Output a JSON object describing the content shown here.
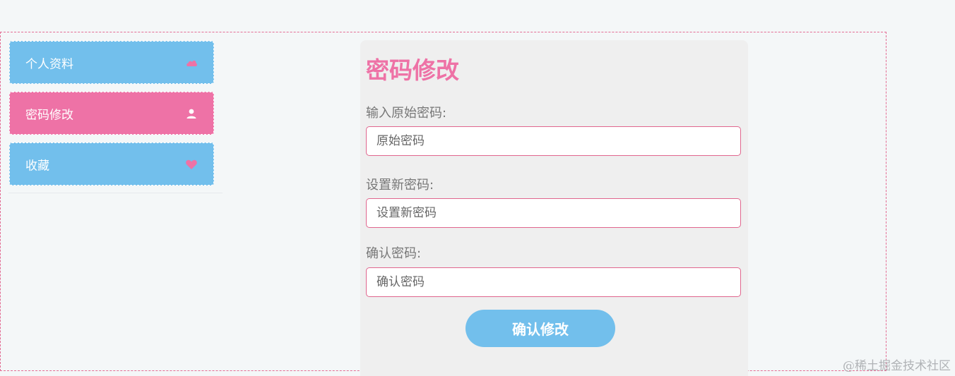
{
  "sidebar": {
    "items": [
      {
        "label": "个人资料",
        "icon": "cloud-icon",
        "color": "#72bfec",
        "active": false
      },
      {
        "label": "密码修改",
        "icon": "user-icon",
        "color": "#ee72a6",
        "active": true
      },
      {
        "label": "收藏",
        "icon": "heart-icon",
        "color": "#72bfec",
        "active": false
      }
    ]
  },
  "form": {
    "title": "密码修改",
    "fields": [
      {
        "label": "输入原始密码:",
        "placeholder": "原始密码",
        "value": ""
      },
      {
        "label": "设置新密码:",
        "placeholder": "设置新密码",
        "value": ""
      },
      {
        "label": "确认密码:",
        "placeholder": "确认密码",
        "value": ""
      }
    ],
    "submit_label": "确认修改"
  },
  "watermark": "@稀土掘金技术社区",
  "colors": {
    "accent_pink": "#ee72a6",
    "accent_blue": "#72bfec",
    "border_pink": "#e0668e",
    "page_bg": "#f4f7f8",
    "card_bg": "#efefef"
  }
}
